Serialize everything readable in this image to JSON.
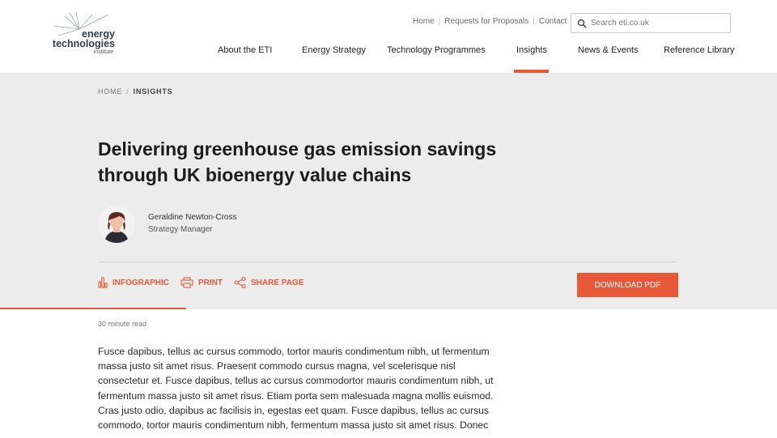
{
  "logo": {
    "line1": "energy",
    "line2": "technologies",
    "line3": "institute"
  },
  "utility_nav": [
    "Home",
    "Requests for Proposals",
    "Contact"
  ],
  "search": {
    "placeholder": "Search eti.co.uk"
  },
  "main_nav": [
    {
      "label": "About the ETI"
    },
    {
      "label": "Energy Strategy"
    },
    {
      "label": "Technology Programmes"
    },
    {
      "label": "Insights"
    },
    {
      "label": "News & Events"
    },
    {
      "label": "Reference Library"
    }
  ],
  "active_nav": "Insights",
  "breadcrumb": {
    "home": "HOME",
    "current": "INSIGHTS"
  },
  "article": {
    "title_line1": "Delivering greenhouse gas emission savings",
    "title_line2": "through UK bioenergy value chains",
    "author_name": "Geraldine Newton-Cross",
    "author_role": "Strategy Manager",
    "read_time": "30 minute read",
    "body_lines": [
      "Fusce dapibus, tellus ac cursus commodo, tortor mauris condimentum nibh, ut fermentum",
      "massa justo sit amet risus. Praesent commodo cursus magna, vel scelerisque nisl",
      "consectetur et. Fusce dapibus, tellus ac cursus commodortor mauris condimentum nibh, ut",
      "fermentum massa justo sit amet risus. Etiam porta sem malesuada magna mollis euismod.",
      "Cras justo odio, dapibus ac facilisis in, egestas eet quam. Fusce dapibus, tellus ac cursus",
      "commodo, tortor mauris condimentum nibh,  fermentum massa justo sit amet risus. Donec"
    ]
  },
  "actions": {
    "infographic": "INFOGRAPHIC",
    "print": "PRINT",
    "share": "SHARE PAGE",
    "download": "DOWNLOAD PDF"
  },
  "colors": {
    "accent": "#e8593a",
    "hero_bg": "#ececec",
    "text": "#1c1c1c"
  },
  "reading_progress": 0.24
}
